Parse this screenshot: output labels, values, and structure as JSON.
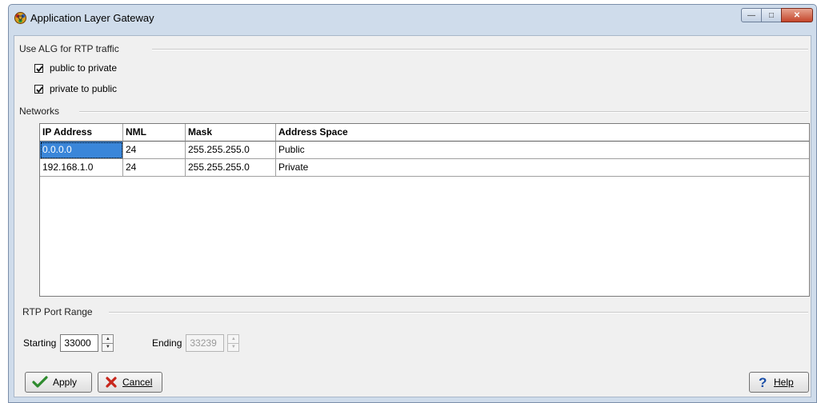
{
  "window": {
    "title": "Application Layer Gateway",
    "minimize_glyph": "—",
    "restore_glyph": "□",
    "close_glyph": "✕"
  },
  "alg_group": {
    "label": "Use ALG for RTP traffic",
    "public_to_private": {
      "label": "public to private",
      "checked": true
    },
    "private_to_public": {
      "label": "private to public",
      "checked": true
    }
  },
  "networks": {
    "label": "Networks",
    "columns": [
      "IP Address",
      "NML",
      "Mask",
      "Address Space"
    ],
    "rows": [
      [
        "0.0.0.0",
        "24",
        "255.255.255.0",
        "Public"
      ],
      [
        "192.168.1.0",
        "24",
        "255.255.255.0",
        "Private"
      ]
    ]
  },
  "rtp_group": {
    "label": "RTP Port Range",
    "starting_label": "Starting",
    "starting_value": "33000",
    "ending_label": "Ending",
    "ending_value": "33239"
  },
  "buttons": {
    "apply": "Apply",
    "cancel": "Cancel",
    "help": "Help"
  },
  "icons": {
    "app": "network-gateway-icon",
    "apply": "checkmark-icon",
    "cancel": "x-icon",
    "help": "question-mark-icon"
  },
  "colors": {
    "selection": "#3a86d9",
    "frame": "#cfdceb",
    "close_button": "#c4452b"
  }
}
